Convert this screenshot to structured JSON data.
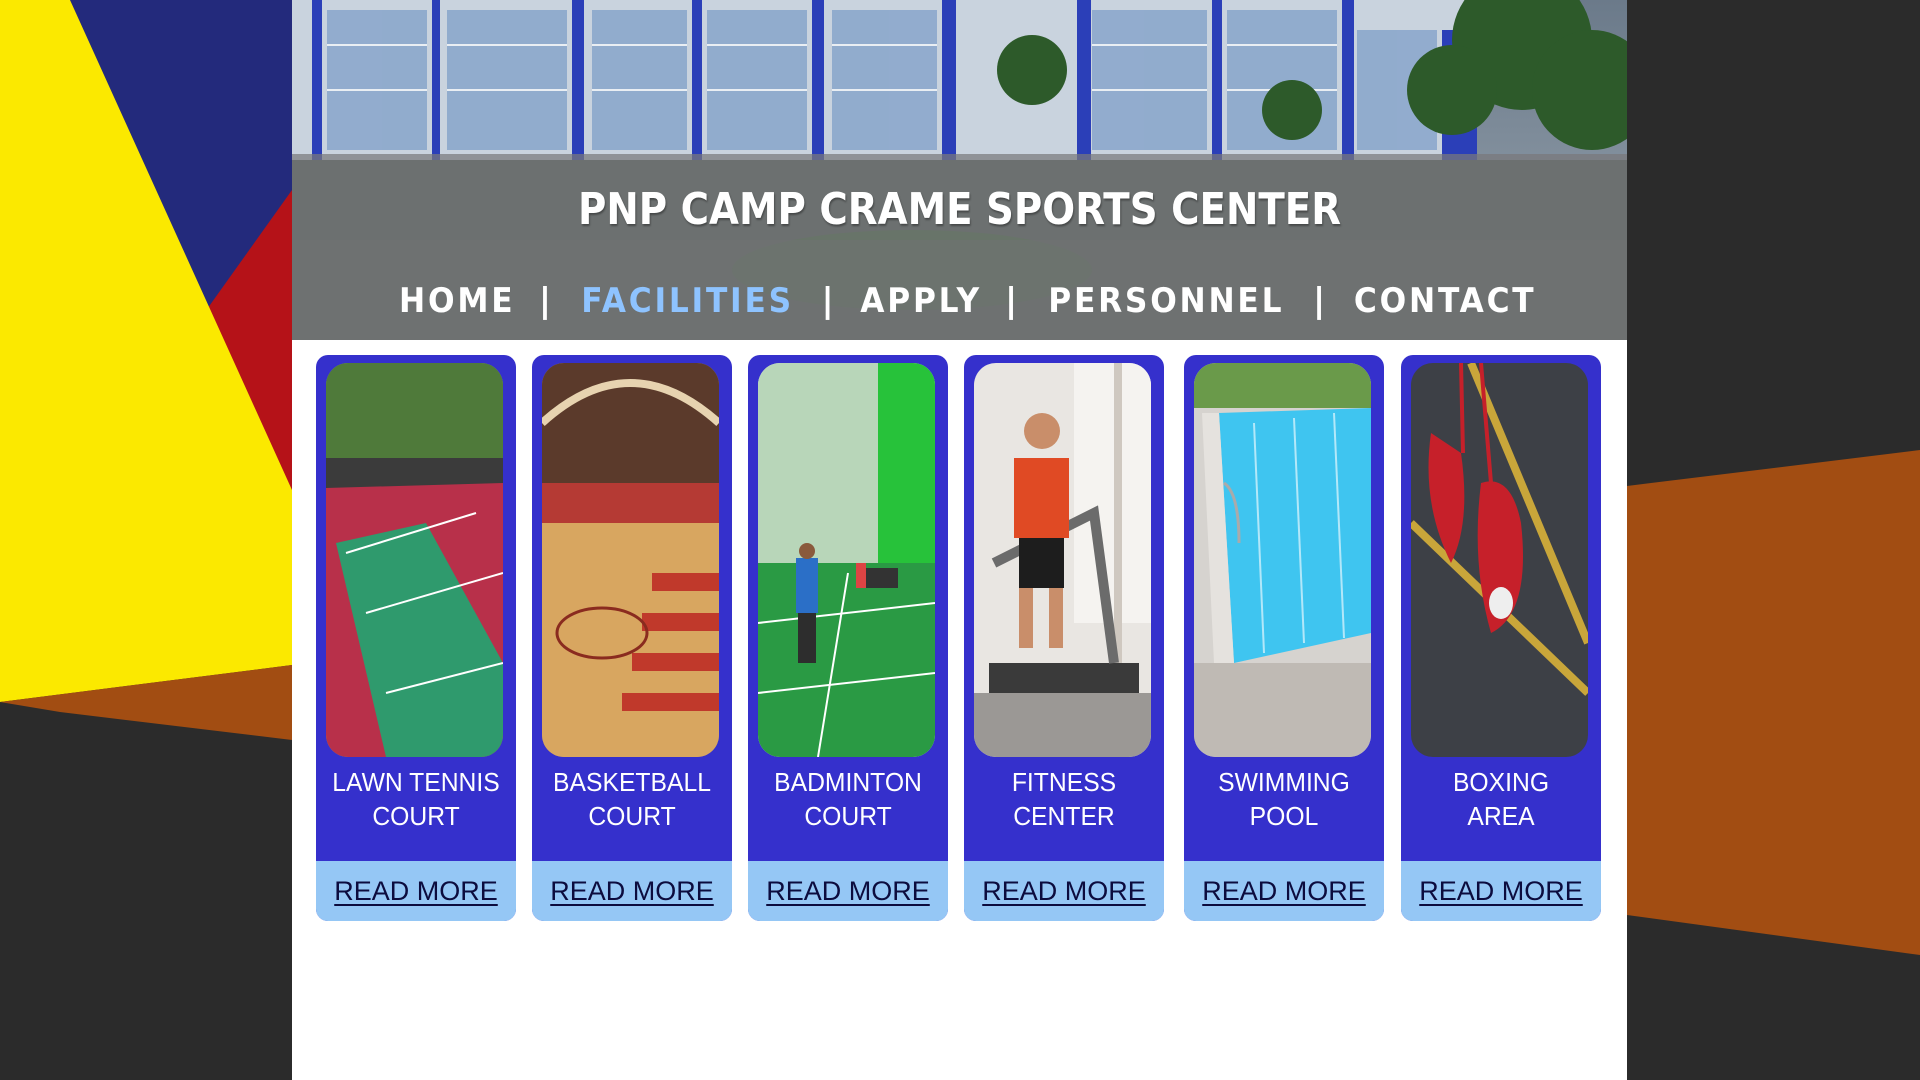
{
  "site": {
    "title": "PNP CAMP CRAME SPORTS CENTER"
  },
  "nav": {
    "items": [
      {
        "label": "HOME",
        "active": false
      },
      {
        "label": "FACILITIES",
        "active": true
      },
      {
        "label": "APPLY",
        "active": false
      },
      {
        "label": "PERSONNEL",
        "active": false
      },
      {
        "label": "CONTACT",
        "active": false
      }
    ],
    "separator": "|"
  },
  "facilities": [
    {
      "line1": "LAWN TENNIS",
      "line2": "COURT",
      "link": "READ MORE",
      "image": "tennis-court-photo"
    },
    {
      "line1": "BASKETBALL",
      "line2": "COURT",
      "link": "READ MORE",
      "image": "basketball-court-photo"
    },
    {
      "line1": "BADMINTON",
      "line2": "COURT",
      "link": "READ MORE",
      "image": "badminton-court-photo"
    },
    {
      "line1": "FITNESS",
      "line2": "CENTER",
      "link": "READ MORE",
      "image": "fitness-center-photo"
    },
    {
      "line1": "SWIMMING",
      "line2": "POOL",
      "link": "READ MORE",
      "image": "swimming-pool-photo"
    },
    {
      "line1": "BOXING",
      "line2": "AREA",
      "link": "READ MORE",
      "image": "boxing-area-photo"
    }
  ],
  "colors": {
    "card": "#3530cc",
    "read_more_bg": "#95c7f5",
    "nav_active": "#8ec3ff",
    "background": "#2b2b2b"
  }
}
